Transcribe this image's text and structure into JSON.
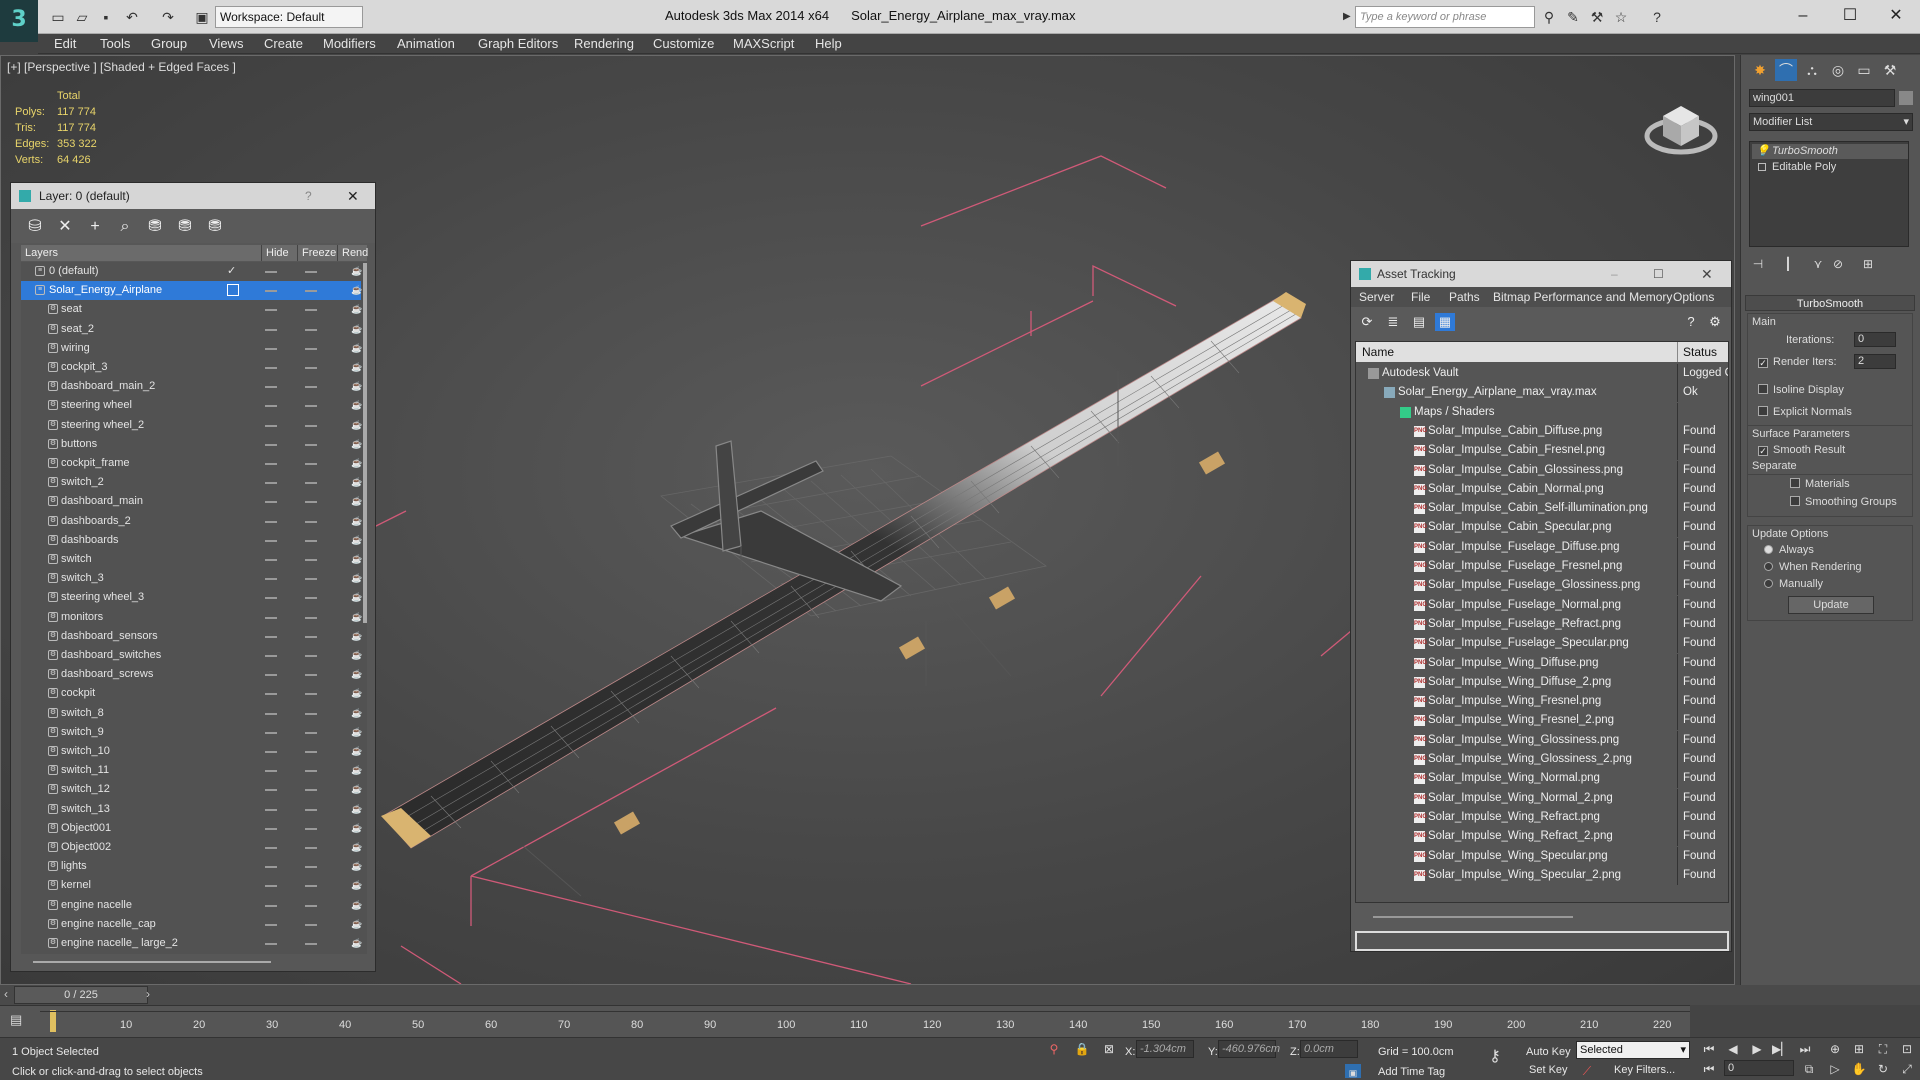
{
  "app": {
    "title": "Autodesk 3ds Max  2014 x64",
    "filename": "Solar_Energy_Airplane_max_vray.max",
    "workspace": "Workspace: Default",
    "search_placeholder": "Type a keyword or phrase"
  },
  "menu": [
    "Edit",
    "Tools",
    "Group",
    "Views",
    "Create",
    "Modifiers",
    "Animation",
    "Graph Editors",
    "Rendering",
    "Customize",
    "MAXScript",
    "Help"
  ],
  "viewport": {
    "label": "[+] [Perspective ] [Shaded + Edged Faces ]",
    "stats": {
      "header": "Total",
      "rows": [
        {
          "k": "Polys:",
          "v": "117 774"
        },
        {
          "k": "Tris:",
          "v": "117 774"
        },
        {
          "k": "Edges:",
          "v": "353 322"
        },
        {
          "k": "Verts:",
          "v": "64 426"
        }
      ]
    }
  },
  "layer_window": {
    "title": "Layer: 0 (default)",
    "help": "?",
    "columns": {
      "layers": "Layers",
      "hide": "Hide",
      "freeze": "Freeze",
      "render": "Rend"
    },
    "rows": [
      {
        "name": "0 (default)",
        "type": "layer"
      },
      {
        "name": "Solar_Energy_Airplane",
        "type": "layer",
        "selected": true
      },
      {
        "name": "seat"
      },
      {
        "name": "seat_2"
      },
      {
        "name": "wiring"
      },
      {
        "name": "cockpit_3"
      },
      {
        "name": "dashboard_main_2"
      },
      {
        "name": "steering wheel"
      },
      {
        "name": "steering wheel_2"
      },
      {
        "name": "buttons"
      },
      {
        "name": "cockpit_frame"
      },
      {
        "name": "switch_2"
      },
      {
        "name": "dashboard_main"
      },
      {
        "name": "dashboards_2"
      },
      {
        "name": "dashboards"
      },
      {
        "name": "switch"
      },
      {
        "name": "switch_3"
      },
      {
        "name": "steering wheel_3"
      },
      {
        "name": "monitors"
      },
      {
        "name": "dashboard_sensors"
      },
      {
        "name": "dashboard_switches"
      },
      {
        "name": "dashboard_screws"
      },
      {
        "name": "cockpit"
      },
      {
        "name": "switch_8"
      },
      {
        "name": "switch_9"
      },
      {
        "name": "switch_10"
      },
      {
        "name": "switch_11"
      },
      {
        "name": "switch_12"
      },
      {
        "name": "switch_13"
      },
      {
        "name": "Object001"
      },
      {
        "name": "Object002"
      },
      {
        "name": "lights"
      },
      {
        "name": "kernel"
      },
      {
        "name": "engine nacelle"
      },
      {
        "name": "engine nacelle_cap"
      },
      {
        "name": "engine nacelle_ large_2"
      }
    ]
  },
  "asset_tracking": {
    "title": "Asset Tracking",
    "menu": [
      "Server",
      "File",
      "Paths",
      "Bitmap Performance and Memory",
      "Options"
    ],
    "columns": {
      "name": "Name",
      "status": "Status"
    },
    "rows": [
      {
        "name": "Autodesk Vault",
        "status": "Logged Out",
        "indent": 1
      },
      {
        "name": "Solar_Energy_Airplane_max_vray.max",
        "status": "Ok",
        "indent": 2
      },
      {
        "name": "Maps / Shaders",
        "status": "",
        "indent": 3
      },
      {
        "name": "Solar_Impulse_Cabin_Diffuse.png",
        "status": "Found",
        "indent": 4
      },
      {
        "name": "Solar_Impulse_Cabin_Fresnel.png",
        "status": "Found",
        "indent": 4
      },
      {
        "name": "Solar_Impulse_Cabin_Glossiness.png",
        "status": "Found",
        "indent": 4
      },
      {
        "name": "Solar_Impulse_Cabin_Normal.png",
        "status": "Found",
        "indent": 4
      },
      {
        "name": "Solar_Impulse_Cabin_Self-illumination.png",
        "status": "Found",
        "indent": 4
      },
      {
        "name": "Solar_Impulse_Cabin_Specular.png",
        "status": "Found",
        "indent": 4
      },
      {
        "name": "Solar_Impulse_Fuselage_Diffuse.png",
        "status": "Found",
        "indent": 4
      },
      {
        "name": "Solar_Impulse_Fuselage_Fresnel.png",
        "status": "Found",
        "indent": 4
      },
      {
        "name": "Solar_Impulse_Fuselage_Glossiness.png",
        "status": "Found",
        "indent": 4
      },
      {
        "name": "Solar_Impulse_Fuselage_Normal.png",
        "status": "Found",
        "indent": 4
      },
      {
        "name": "Solar_Impulse_Fuselage_Refract.png",
        "status": "Found",
        "indent": 4
      },
      {
        "name": "Solar_Impulse_Fuselage_Specular.png",
        "status": "Found",
        "indent": 4
      },
      {
        "name": "Solar_Impulse_Wing_Diffuse.png",
        "status": "Found",
        "indent": 4
      },
      {
        "name": "Solar_Impulse_Wing_Diffuse_2.png",
        "status": "Found",
        "indent": 4
      },
      {
        "name": "Solar_Impulse_Wing_Fresnel.png",
        "status": "Found",
        "indent": 4
      },
      {
        "name": "Solar_Impulse_Wing_Fresnel_2.png",
        "status": "Found",
        "indent": 4
      },
      {
        "name": "Solar_Impulse_Wing_Glossiness.png",
        "status": "Found",
        "indent": 4
      },
      {
        "name": "Solar_Impulse_Wing_Glossiness_2.png",
        "status": "Found",
        "indent": 4
      },
      {
        "name": "Solar_Impulse_Wing_Normal.png",
        "status": "Found",
        "indent": 4
      },
      {
        "name": "Solar_Impulse_Wing_Normal_2.png",
        "status": "Found",
        "indent": 4
      },
      {
        "name": "Solar_Impulse_Wing_Refract.png",
        "status": "Found",
        "indent": 4
      },
      {
        "name": "Solar_Impulse_Wing_Refract_2.png",
        "status": "Found",
        "indent": 4
      },
      {
        "name": "Solar_Impulse_Wing_Specular.png",
        "status": "Found",
        "indent": 4
      },
      {
        "name": "Solar_Impulse_Wing_Specular_2.png",
        "status": "Found",
        "indent": 4
      }
    ]
  },
  "command_panel": {
    "object_name": "wing001",
    "modifier_list": "Modifier List",
    "stack": [
      "TurboSmooth",
      "Editable Poly"
    ],
    "rollout_title": "TurboSmooth",
    "main_label": "Main",
    "iterations_label": "Iterations:",
    "iterations_value": "0",
    "render_iters_label": "Render Iters:",
    "render_iters_value": "2",
    "isoline": "Isoline Display",
    "explicit_normals": "Explicit Normals",
    "surface_params": "Surface Parameters",
    "smooth_result": "Smooth Result",
    "separate": "Separate",
    "materials": "Materials",
    "smoothing_groups": "Smoothing Groups",
    "update_options": "Update Options",
    "always": "Always",
    "when_rendering": "When Rendering",
    "manually": "Manually",
    "update_button": "Update"
  },
  "timeline": {
    "frame": "0 / 225",
    "ticks": [
      "10",
      "20",
      "30",
      "40",
      "50",
      "60",
      "70",
      "80",
      "90",
      "100",
      "110",
      "120",
      "130",
      "140",
      "150",
      "160",
      "170",
      "180",
      "190",
      "200",
      "210",
      "220"
    ]
  },
  "status": {
    "selected": "1 Object Selected",
    "hint": "Click or click-and-drag to select objects",
    "x_label": "X:",
    "x_value": "-1.304cm",
    "y_label": "Y:",
    "y_value": "-460.976cm",
    "z_label": "Z:",
    "z_value": "0.0cm",
    "grid": "Grid = 100.0cm",
    "auto_key": "Auto Key",
    "selected_dropdown": "Selected",
    "set_key": "Set Key",
    "key_filters": "Key Filters...",
    "add_time_tag": "Add Time Tag",
    "frame_value": "0"
  }
}
